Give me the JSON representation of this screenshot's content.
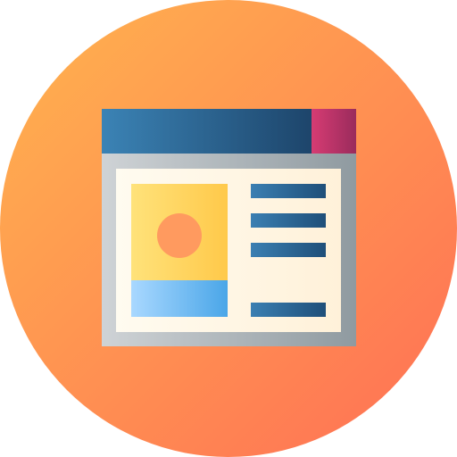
{
  "icon": {
    "name": "web-page-layout-icon",
    "parts": [
      "circle-background",
      "browser-window",
      "title-bar",
      "window-control",
      "content-panel",
      "image-card",
      "profile-avatar",
      "text-line"
    ],
    "colors": {
      "background_gradient": [
        "#ffb44e",
        "#ff6f55"
      ],
      "frame_gradient": [
        "#cfd3d6",
        "#8f9aa0"
      ],
      "title_bar_gradient": [
        "#3b83b5",
        "#1d456b"
      ],
      "window_control_gradient": [
        "#d63c73",
        "#9a2b5c"
      ],
      "content_panel_gradient": [
        "#fffbf0",
        "#fff1d9"
      ],
      "image_card_gradient": [
        "#ffe27a",
        "#ffc94a"
      ],
      "image_card_footer_gradient": [
        "#a9d8ff",
        "#4aa6e8"
      ],
      "avatar": "#ff9a5f",
      "text_line_gradient": [
        "#3b7fb2",
        "#1f4f79"
      ]
    },
    "text_lines": 4
  }
}
